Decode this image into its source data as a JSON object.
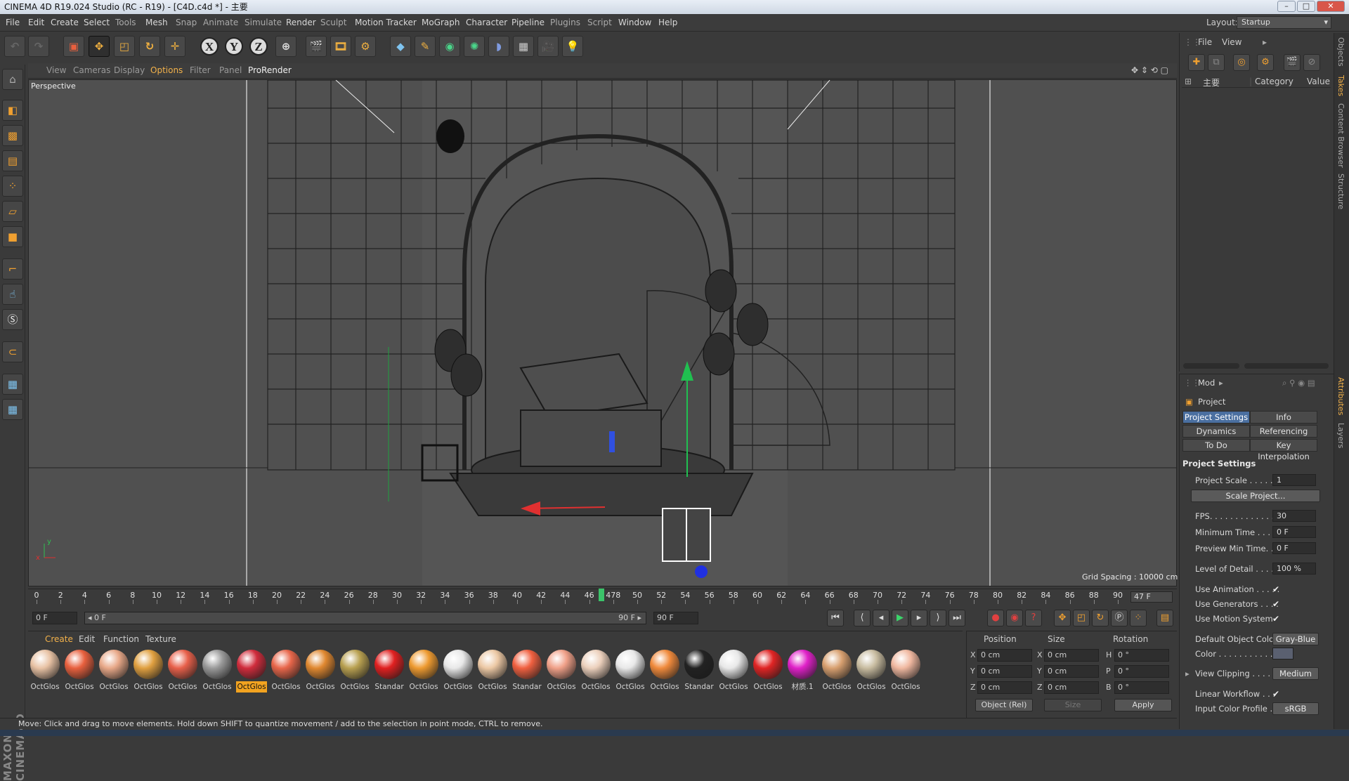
{
  "window": {
    "title": "CINEMA 4D R19.024 Studio (RC - R19) - [C4D.c4d *] - 主要",
    "min": "–",
    "max": "□",
    "close": "✕"
  },
  "menubar": {
    "items": [
      "File",
      "Edit",
      "Create",
      "Select",
      "Tools",
      "Mesh",
      "Snap",
      "Animate",
      "Simulate",
      "Sculpt",
      "Render",
      "Sculpt",
      "Motion Tracker",
      "MoGraph",
      "Character",
      "Pipeline",
      "Plugins",
      "Script",
      "Window",
      "Help"
    ],
    "layout_label": "Layout:",
    "layout_value": "Startup"
  },
  "toolbar": {
    "axis_x": "X",
    "axis_y": "Y",
    "axis_z": "Z"
  },
  "viewport": {
    "menu": [
      "View",
      "Cameras",
      "Display",
      "Options",
      "Filter",
      "Panel",
      "ProRender"
    ],
    "view_name": "Perspective",
    "grid_spacing": "Grid Spacing : 10000 cm"
  },
  "timeline": {
    "ticks": [
      "0",
      "2",
      "4",
      "6",
      "8",
      "10",
      "12",
      "14",
      "16",
      "18",
      "20",
      "22",
      "24",
      "26",
      "28",
      "30",
      "32",
      "34",
      "36",
      "38",
      "40",
      "42",
      "44",
      "46",
      "478",
      "50",
      "52",
      "54",
      "56",
      "58",
      "60",
      "62",
      "64",
      "66",
      "68",
      "70",
      "72",
      "74",
      "76",
      "78",
      "80",
      "82",
      "84",
      "86",
      "88",
      "90"
    ],
    "current_frame": 47,
    "end_frame": "47 F"
  },
  "transport": {
    "start_field": "0 F",
    "range_start": "◂ 0 F",
    "range_end": "90 F ▸",
    "max_field": "90 F"
  },
  "material_manager": {
    "menu": [
      "Create",
      "Edit",
      "Function",
      "Texture"
    ],
    "materials": [
      {
        "label": "OctGlos",
        "color": "#e8c2a4"
      },
      {
        "label": "OctGlos",
        "color": "#e8603e"
      },
      {
        "label": "OctGlos",
        "color": "#e8a888"
      },
      {
        "label": "OctGlos",
        "color": "#e0a040"
      },
      {
        "label": "OctGlos",
        "color": "#e8604a"
      },
      {
        "label": "OctGlos",
        "color": "#9a9a9a"
      },
      {
        "label": "OctGlos",
        "color": "#d02c3c",
        "selected": true
      },
      {
        "label": "OctGlos",
        "color": "#e8664a"
      },
      {
        "label": "OctGlos",
        "color": "#e08830"
      },
      {
        "label": "OctGlos",
        "color": "#b8a050"
      },
      {
        "label": "Standar",
        "color": "#e02020"
      },
      {
        "label": "OctGlos",
        "color": "#ee9a30"
      },
      {
        "label": "OctGlos",
        "color": "#e8e8e8"
      },
      {
        "label": "OctGlos",
        "color": "#ecc8a4"
      },
      {
        "label": "Standar",
        "color": "#f06040"
      },
      {
        "label": "OctGlos",
        "color": "#f0a088"
      },
      {
        "label": "OctGlos",
        "color": "#ecd0bc"
      },
      {
        "label": "OctGlos",
        "color": "#e8e8e8"
      },
      {
        "label": "OctGlos",
        "color": "#f08a3c"
      },
      {
        "label": "Standar",
        "color": "#222222"
      },
      {
        "label": "OctGlos",
        "color": "#e8e8e8"
      },
      {
        "label": "OctGlos",
        "color": "#e02424"
      },
      {
        "label": "材质.1",
        "color": "#e020c8"
      },
      {
        "label": "OctGlos",
        "color": "#d8a070"
      },
      {
        "label": "OctGlos",
        "color": "#c8bca0"
      },
      {
        "label": "OctGlos",
        "color": "#f0b8a0"
      }
    ]
  },
  "coord_manager": {
    "headers": [
      "Position",
      "Size",
      "Rotation"
    ],
    "rows": [
      {
        "axis": "X",
        "pos": "0 cm",
        "size_axis": "X",
        "size": "0 cm",
        "rot_axis": "H",
        "rot": "0 °"
      },
      {
        "axis": "Y",
        "pos": "0 cm",
        "size_axis": "Y",
        "size": "0 cm",
        "rot_axis": "P",
        "rot": "0 °"
      },
      {
        "axis": "Z",
        "pos": "0 cm",
        "size_axis": "Z",
        "size": "0 cm",
        "rot_axis": "B",
        "rot": "0 °"
      }
    ],
    "mode": "Object (Rel)",
    "size_mode": "Size",
    "apply": "Apply"
  },
  "status": "Move: Click and drag to move elements. Hold down SHIFT to quantize movement / add to the selection in point mode, CTRL to remove.",
  "object_panel": {
    "menu": [
      "File",
      "View"
    ],
    "columns": [
      "主要",
      "Category",
      "Value"
    ]
  },
  "attributes": {
    "mode": "Mod",
    "object": "Project",
    "tabs": [
      "Project Settings",
      "Info",
      "Dynamics",
      "Referencing",
      "To Do",
      "Key Interpolation"
    ],
    "section": "Project Settings",
    "fields": {
      "project_scale_label": "Project Scale . . . . . .",
      "project_scale": "1",
      "scale_project": "Scale Project...",
      "fps_label": "FPS. . . . . . . . . . . . . .",
      "fps": "30",
      "min_time_label": "Minimum Time . . . . .",
      "min_time": "0 F",
      "preview_min_label": "Preview Min Time. . .",
      "preview_min": "0 F",
      "lod_label": "Level of Detail . . . . .",
      "lod": "100 %",
      "use_anim_label": "Use Animation . . . . .",
      "use_gen_label": "Use Generators . . . .",
      "use_motion_label": "Use Motion System",
      "def_color_label": "Default Object Color",
      "def_color": "Gray-Blue",
      "color_label": "Color . . . . . . . . . . .",
      "view_clip_label": "View Clipping . . . . .",
      "view_clip": "Medium",
      "linear_wf_label": "Linear Workflow . . .",
      "input_profile_label": "Input Color Profile . .",
      "input_profile": "sRGB",
      "check": "✔"
    }
  },
  "side_tabs": [
    "Objects",
    "Takes",
    "Content Browser",
    "Structure",
    "Attributes",
    "Layers"
  ]
}
